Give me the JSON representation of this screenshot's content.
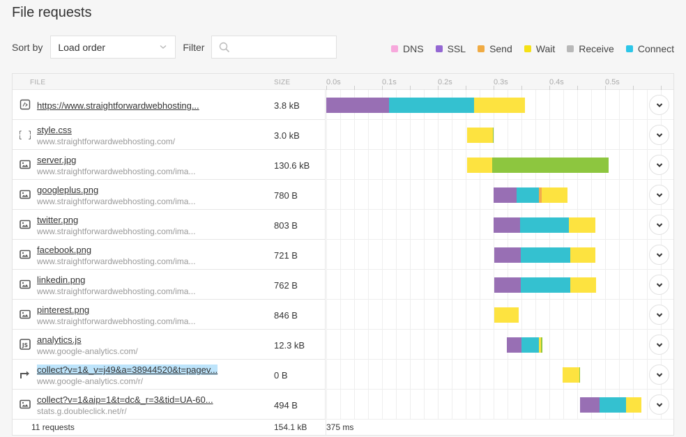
{
  "page": {
    "title": "File requests"
  },
  "controls": {
    "sort_label": "Sort by",
    "sort_value": "Load order",
    "filter_label": "Filter",
    "filter_placeholder": "",
    "filter_value": ""
  },
  "legend": [
    {
      "key": "dns",
      "label": "DNS",
      "color": "#f7a8dc"
    },
    {
      "key": "ssl",
      "label": "SSL",
      "color": "#9467d3"
    },
    {
      "key": "send",
      "label": "Send",
      "color": "#f0ab43"
    },
    {
      "key": "wait",
      "label": "Wait",
      "color": "#f5e116"
    },
    {
      "key": "receive",
      "label": "Receive",
      "color": "#b8b8b8"
    },
    {
      "key": "connect",
      "label": "Connect",
      "color": "#2cc6e8"
    }
  ],
  "bar_colors": {
    "ssl": "#986fb4",
    "connect": "#34c1d0",
    "send": "#f3ab4c",
    "wait": "#fde340",
    "receive": "#8dc63f"
  },
  "table": {
    "col_file": "FILE",
    "col_size": "SIZE",
    "axis_ticks": [
      "0.0s",
      "0.1s",
      "0.2s",
      "0.3s",
      "0.4s",
      "0.5s"
    ],
    "axis_max_seconds": 0.6,
    "rows": [
      {
        "icon": "html",
        "name": "https://www.straightforwardwebhosting...",
        "host": "",
        "size": "3.8 kB",
        "highlight": false,
        "segments": [
          {
            "type": "ssl",
            "start": 0.0,
            "end": 0.1125
          },
          {
            "type": "connect",
            "start": 0.1125,
            "end": 0.265
          },
          {
            "type": "wait",
            "start": 0.265,
            "end": 0.356
          }
        ]
      },
      {
        "icon": "css",
        "name": "style.css",
        "host": "www.straightforwardwebhosting.com/",
        "size": "3.0 kB",
        "highlight": false,
        "segments": [
          {
            "type": "wait",
            "start": 0.2525,
            "end": 0.2985
          },
          {
            "type": "receive",
            "start": 0.2985,
            "end": 0.2995
          }
        ]
      },
      {
        "icon": "image",
        "name": "server.jpg",
        "host": "www.straightforwardwebhosting.com/ima...",
        "size": "130.6 kB",
        "highlight": false,
        "segments": [
          {
            "type": "wait",
            "start": 0.2525,
            "end": 0.2975
          },
          {
            "type": "receive",
            "start": 0.2975,
            "end": 0.506
          }
        ]
      },
      {
        "icon": "image",
        "name": "googleplus.png",
        "host": "www.straightforwardwebhosting.com/ima...",
        "size": "780 B",
        "highlight": false,
        "segments": [
          {
            "type": "ssl",
            "start": 0.3,
            "end": 0.341
          },
          {
            "type": "connect",
            "start": 0.341,
            "end": 0.381
          },
          {
            "type": "send",
            "start": 0.381,
            "end": 0.386
          },
          {
            "type": "wait",
            "start": 0.386,
            "end": 0.4325
          }
        ]
      },
      {
        "icon": "image",
        "name": "twitter.png",
        "host": "www.straightforwardwebhosting.com/ima...",
        "size": "803 B",
        "highlight": false,
        "segments": [
          {
            "type": "ssl",
            "start": 0.3,
            "end": 0.3475
          },
          {
            "type": "connect",
            "start": 0.3475,
            "end": 0.4355
          },
          {
            "type": "wait",
            "start": 0.4355,
            "end": 0.4825
          }
        ]
      },
      {
        "icon": "image",
        "name": "facebook.png",
        "host": "www.straightforwardwebhosting.com/ima...",
        "size": "721 B",
        "highlight": false,
        "segments": [
          {
            "type": "ssl",
            "start": 0.301,
            "end": 0.3485
          },
          {
            "type": "connect",
            "start": 0.3485,
            "end": 0.437
          },
          {
            "type": "wait",
            "start": 0.437,
            "end": 0.4825
          }
        ]
      },
      {
        "icon": "image",
        "name": "linkedin.png",
        "host": "www.straightforwardwebhosting.com/ima...",
        "size": "762 B",
        "highlight": false,
        "segments": [
          {
            "type": "ssl",
            "start": 0.301,
            "end": 0.3485
          },
          {
            "type": "connect",
            "start": 0.3485,
            "end": 0.438
          },
          {
            "type": "wait",
            "start": 0.438,
            "end": 0.4835
          }
        ]
      },
      {
        "icon": "image",
        "name": "pinterest.png",
        "host": "www.straightforwardwebhosting.com/ima...",
        "size": "846 B",
        "highlight": false,
        "segments": [
          {
            "type": "wait",
            "start": 0.301,
            "end": 0.3445
          }
        ]
      },
      {
        "icon": "js",
        "name": "analytics.js",
        "host": "www.google-analytics.com/",
        "size": "12.3 kB",
        "highlight": false,
        "segments": [
          {
            "type": "ssl",
            "start": 0.3235,
            "end": 0.3505
          },
          {
            "type": "connect",
            "start": 0.3505,
            "end": 0.381
          },
          {
            "type": "wait",
            "start": 0.381,
            "end": 0.385
          },
          {
            "type": "receive",
            "start": 0.385,
            "end": 0.3875
          }
        ]
      },
      {
        "icon": "redirect",
        "name": "collect?v=1&_v=j49&a=38944520&t=pagev...",
        "host": "www.google-analytics.com/r/",
        "size": "0 B",
        "highlight": true,
        "segments": [
          {
            "type": "wait",
            "start": 0.4235,
            "end": 0.4535
          },
          {
            "type": "receive",
            "start": 0.4535,
            "end": 0.4548
          }
        ]
      },
      {
        "icon": "image",
        "name": "collect?v=1&aip=1&t=dc&_r=3&tid=UA-60...",
        "host": "stats.g.doubleclick.net/r/",
        "size": "494 B",
        "highlight": false,
        "segments": [
          {
            "type": "ssl",
            "start": 0.455,
            "end": 0.4905
          },
          {
            "type": "connect",
            "start": 0.4905,
            "end": 0.538
          },
          {
            "type": "wait",
            "start": 0.538,
            "end": 0.5645
          }
        ]
      }
    ]
  },
  "footer": {
    "request_count": "11 requests",
    "total_size": "154.1 kB",
    "total_time": "375 ms"
  }
}
